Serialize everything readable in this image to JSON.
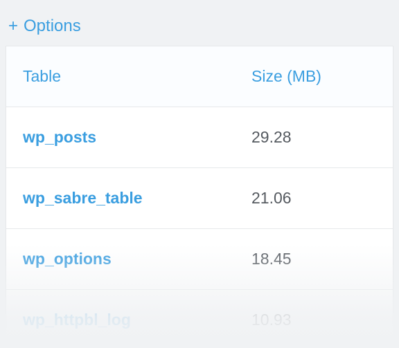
{
  "options_label": "Options",
  "columns": {
    "table": "Table",
    "size": "Size (MB)"
  },
  "rows": [
    {
      "name": "wp_posts",
      "size": "29.28"
    },
    {
      "name": "wp_sabre_table",
      "size": "21.06"
    },
    {
      "name": "wp_options",
      "size": "18.45"
    },
    {
      "name": "wp_httpbl_log",
      "size": "10.93"
    }
  ],
  "chart_data": {
    "type": "table",
    "columns": [
      "Table",
      "Size (MB)"
    ],
    "rows": [
      [
        "wp_posts",
        29.28
      ],
      [
        "wp_sabre_table",
        21.06
      ],
      [
        "wp_options",
        18.45
      ],
      [
        "wp_httpbl_log",
        10.93
      ]
    ]
  }
}
